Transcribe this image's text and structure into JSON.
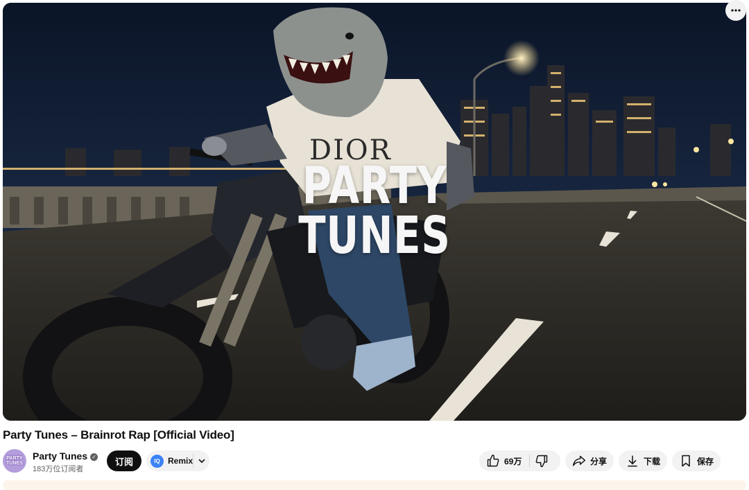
{
  "video": {
    "overlay_text_line1": "PARTY",
    "overlay_text_line2": "TUNES",
    "shirt_text": "DIOR"
  },
  "title": "Party Tunes – Brainrot Rap [Official Video]",
  "channel": {
    "avatar_text": "PARTY TUNES",
    "name": "Party Tunes",
    "verified_icon": "check-circle-icon",
    "subscribers": "183万位订阅者"
  },
  "actions": {
    "subscribe_label": "订阅",
    "remix_icon_text": "IQ",
    "remix_label": "Remix",
    "like_count": "69万",
    "share_label": "分享",
    "download_label": "下载",
    "save_label": "保存"
  },
  "colors": {
    "subscribe_bg": "#0f0f0f",
    "pill_bg": "#f2f2f2",
    "remix_accent": "#3b82f6",
    "avatar_bg": "#b39ddb"
  }
}
